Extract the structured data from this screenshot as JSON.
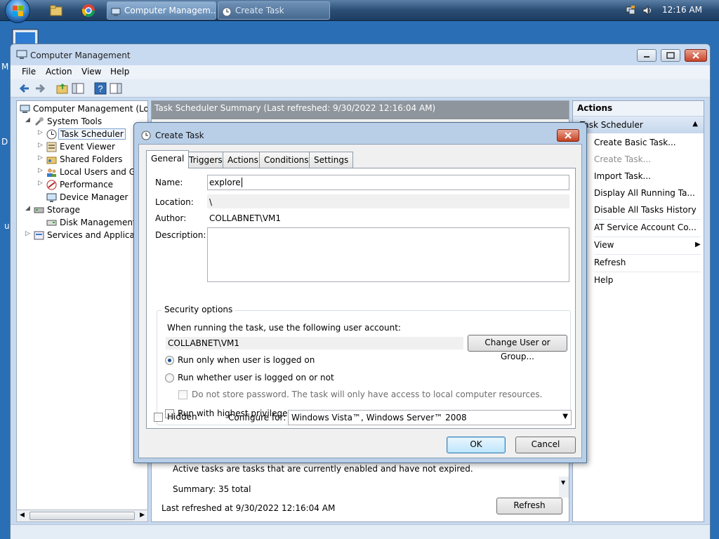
{
  "taskbar": {
    "tasks": [
      {
        "label": "Computer Managem..."
      },
      {
        "label": "Create Task"
      }
    ],
    "clock": "12:16 AM"
  },
  "desktop": {
    "partial_texts": [
      "M",
      "D",
      "u"
    ]
  },
  "window": {
    "title": "Computer Management",
    "menu": [
      "File",
      "Action",
      "View",
      "Help"
    ]
  },
  "tree": {
    "items": [
      {
        "label": "Computer Management (Local"
      },
      {
        "label": "System Tools"
      },
      {
        "label": "Task Scheduler"
      },
      {
        "label": "Event Viewer"
      },
      {
        "label": "Shared Folders"
      },
      {
        "label": "Local Users and Gro"
      },
      {
        "label": "Performance"
      },
      {
        "label": "Device Manager"
      },
      {
        "label": "Storage"
      },
      {
        "label": "Disk Management"
      },
      {
        "label": "Services and Application"
      }
    ]
  },
  "center": {
    "header": "Task Scheduler Summary (Last refreshed: 9/30/2022 12:16:04 AM)",
    "active_text": "Active tasks are tasks that are currently enabled and have not expired.",
    "summary": "Summary: 35 total",
    "last_refreshed": "Last refreshed at 9/30/2022 12:16:04 AM",
    "refresh_label": "Refresh"
  },
  "actions": {
    "header": "Actions",
    "section": "Task Scheduler",
    "items": [
      {
        "label": "Create Basic Task...",
        "disabled": false
      },
      {
        "label": "Create Task...",
        "disabled": true
      },
      {
        "label": "Import Task...",
        "disabled": false
      },
      {
        "label": "Display All Running Ta...",
        "disabled": false
      },
      {
        "label": "Disable All Tasks History",
        "disabled": false
      },
      {
        "label": "AT Service Account Co...",
        "disabled": false
      },
      {
        "label": "View",
        "disabled": false
      },
      {
        "label": "Refresh",
        "disabled": false
      },
      {
        "label": "Help",
        "disabled": false
      }
    ]
  },
  "dialog": {
    "title": "Create Task",
    "tabs": [
      "General",
      "Triggers",
      "Actions",
      "Conditions",
      "Settings"
    ],
    "active_tab": "General",
    "name_label": "Name:",
    "name_value": "explore",
    "location_label": "Location:",
    "location_value": "\\",
    "author_label": "Author:",
    "author_value": "COLLABNET\\VM1",
    "description_label": "Description:",
    "description_value": "",
    "security": {
      "legend": "Security options",
      "account_prompt": "When running the task, use the following user account:",
      "account_value": "COLLABNET\\VM1",
      "change_button": "Change User or Group...",
      "radio_logged_on": "Run only when user is logged on",
      "radio_whether": "Run whether user is logged on or not",
      "no_store_password": "Do not store password.  The task will only have access to local computer resources.",
      "highest_privileges": "Run with highest privileges"
    },
    "hidden_label": "Hidden",
    "configure_label": "Configure for:",
    "configure_value": "Windows Vista™, Windows Server™ 2008",
    "ok_label": "OK",
    "cancel_label": "Cancel"
  }
}
